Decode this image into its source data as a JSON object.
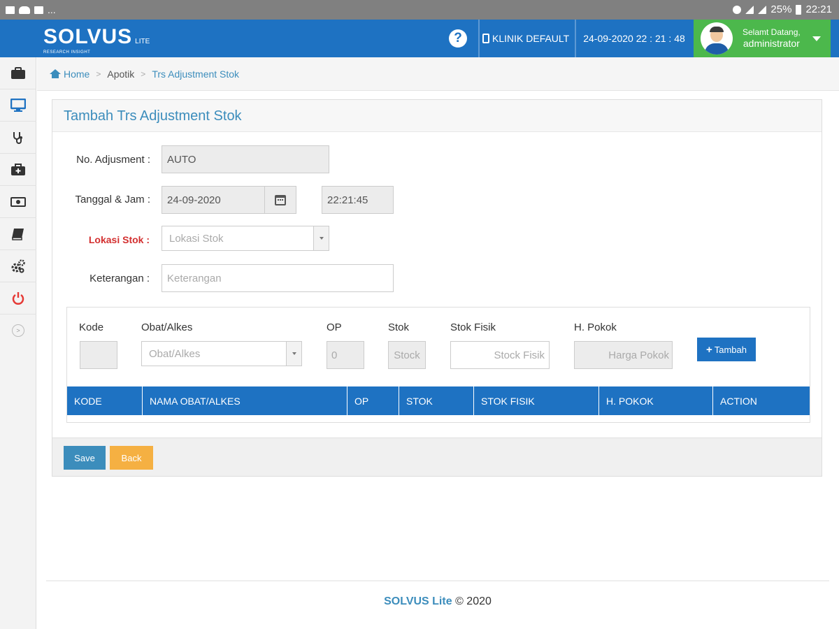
{
  "status_bar": {
    "left_more": "...",
    "battery": "25%",
    "time": "22:21"
  },
  "header": {
    "brand": "SOLVUS",
    "brand_sub": "LITE",
    "brand_tagline": "RESEARCH INSIGHT",
    "help": "?",
    "clinic": "KLINIK DEFAULT",
    "datetime": "24-09-2020 22 : 21 : 48",
    "greeting": "Selamt Datang,",
    "username": "administrator"
  },
  "sidebar": {
    "items": [
      "briefcase-icon",
      "monitor-icon",
      "stethoscope-icon",
      "medkit-icon",
      "money-icon",
      "book-icon",
      "cogs-icon",
      "power-icon"
    ],
    "collapse": ">"
  },
  "breadcrumb": {
    "home": "Home",
    "level1": "Apotik",
    "current": "Trs Adjustment Stok"
  },
  "form": {
    "title": "Tambah Trs Adjustment Stok",
    "no_label": "No. Adjusment :",
    "no_value": "AUTO",
    "date_label": "Tanggal & Jam :",
    "date_value": "24-09-2020",
    "time_value": "22:21:45",
    "lokasi_label": "Lokasi Stok :",
    "lokasi_placeholder": "Lokasi Stok",
    "ket_label": "Keterangan :",
    "ket_placeholder": "Keterangan"
  },
  "detail": {
    "kode_label": "Kode",
    "obat_label": "Obat/Alkes",
    "obat_placeholder": "Obat/Alkes",
    "op_label": "OP",
    "op_placeholder": "0",
    "stok_label": "Stok",
    "stok_placeholder": "Stock",
    "fisik_label": "Stok Fisik",
    "fisik_placeholder": "Stock Fisik",
    "pokok_label": "H. Pokok",
    "pokok_placeholder": "Harga Pokok",
    "add_button": "Tambah"
  },
  "table": {
    "columns": [
      "KODE",
      "NAMA OBAT/ALKES",
      "OP",
      "STOK",
      "STOK FISIK",
      "H. POKOK",
      "ACTION"
    ]
  },
  "buttons": {
    "save": "Save",
    "back": "Back"
  },
  "footer": {
    "brand": "SOLVUS Lite",
    "copy": "© 2020"
  },
  "colors": {
    "primary": "#1e72c2",
    "user_bg": "#4cb84c",
    "back_btn": "#f5b042",
    "required": "#d32f2f"
  }
}
